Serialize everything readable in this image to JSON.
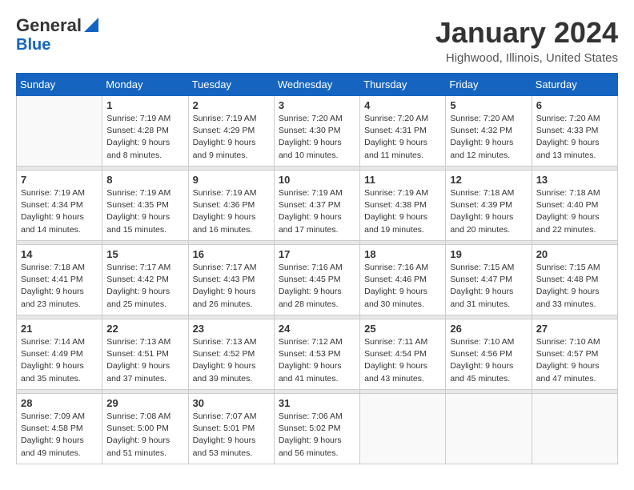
{
  "header": {
    "logo_line1": "General",
    "logo_line2": "Blue",
    "month_title": "January 2024",
    "location": "Highwood, Illinois, United States"
  },
  "weekdays": [
    "Sunday",
    "Monday",
    "Tuesday",
    "Wednesday",
    "Thursday",
    "Friday",
    "Saturday"
  ],
  "weeks": [
    [
      {
        "day": "",
        "info": ""
      },
      {
        "day": "1",
        "info": "Sunrise: 7:19 AM\nSunset: 4:28 PM\nDaylight: 9 hours\nand 8 minutes."
      },
      {
        "day": "2",
        "info": "Sunrise: 7:19 AM\nSunset: 4:29 PM\nDaylight: 9 hours\nand 9 minutes."
      },
      {
        "day": "3",
        "info": "Sunrise: 7:20 AM\nSunset: 4:30 PM\nDaylight: 9 hours\nand 10 minutes."
      },
      {
        "day": "4",
        "info": "Sunrise: 7:20 AM\nSunset: 4:31 PM\nDaylight: 9 hours\nand 11 minutes."
      },
      {
        "day": "5",
        "info": "Sunrise: 7:20 AM\nSunset: 4:32 PM\nDaylight: 9 hours\nand 12 minutes."
      },
      {
        "day": "6",
        "info": "Sunrise: 7:20 AM\nSunset: 4:33 PM\nDaylight: 9 hours\nand 13 minutes."
      }
    ],
    [
      {
        "day": "7",
        "info": "Sunrise: 7:19 AM\nSunset: 4:34 PM\nDaylight: 9 hours\nand 14 minutes."
      },
      {
        "day": "8",
        "info": "Sunrise: 7:19 AM\nSunset: 4:35 PM\nDaylight: 9 hours\nand 15 minutes."
      },
      {
        "day": "9",
        "info": "Sunrise: 7:19 AM\nSunset: 4:36 PM\nDaylight: 9 hours\nand 16 minutes."
      },
      {
        "day": "10",
        "info": "Sunrise: 7:19 AM\nSunset: 4:37 PM\nDaylight: 9 hours\nand 17 minutes."
      },
      {
        "day": "11",
        "info": "Sunrise: 7:19 AM\nSunset: 4:38 PM\nDaylight: 9 hours\nand 19 minutes."
      },
      {
        "day": "12",
        "info": "Sunrise: 7:18 AM\nSunset: 4:39 PM\nDaylight: 9 hours\nand 20 minutes."
      },
      {
        "day": "13",
        "info": "Sunrise: 7:18 AM\nSunset: 4:40 PM\nDaylight: 9 hours\nand 22 minutes."
      }
    ],
    [
      {
        "day": "14",
        "info": "Sunrise: 7:18 AM\nSunset: 4:41 PM\nDaylight: 9 hours\nand 23 minutes."
      },
      {
        "day": "15",
        "info": "Sunrise: 7:17 AM\nSunset: 4:42 PM\nDaylight: 9 hours\nand 25 minutes."
      },
      {
        "day": "16",
        "info": "Sunrise: 7:17 AM\nSunset: 4:43 PM\nDaylight: 9 hours\nand 26 minutes."
      },
      {
        "day": "17",
        "info": "Sunrise: 7:16 AM\nSunset: 4:45 PM\nDaylight: 9 hours\nand 28 minutes."
      },
      {
        "day": "18",
        "info": "Sunrise: 7:16 AM\nSunset: 4:46 PM\nDaylight: 9 hours\nand 30 minutes."
      },
      {
        "day": "19",
        "info": "Sunrise: 7:15 AM\nSunset: 4:47 PM\nDaylight: 9 hours\nand 31 minutes."
      },
      {
        "day": "20",
        "info": "Sunrise: 7:15 AM\nSunset: 4:48 PM\nDaylight: 9 hours\nand 33 minutes."
      }
    ],
    [
      {
        "day": "21",
        "info": "Sunrise: 7:14 AM\nSunset: 4:49 PM\nDaylight: 9 hours\nand 35 minutes."
      },
      {
        "day": "22",
        "info": "Sunrise: 7:13 AM\nSunset: 4:51 PM\nDaylight: 9 hours\nand 37 minutes."
      },
      {
        "day": "23",
        "info": "Sunrise: 7:13 AM\nSunset: 4:52 PM\nDaylight: 9 hours\nand 39 minutes."
      },
      {
        "day": "24",
        "info": "Sunrise: 7:12 AM\nSunset: 4:53 PM\nDaylight: 9 hours\nand 41 minutes."
      },
      {
        "day": "25",
        "info": "Sunrise: 7:11 AM\nSunset: 4:54 PM\nDaylight: 9 hours\nand 43 minutes."
      },
      {
        "day": "26",
        "info": "Sunrise: 7:10 AM\nSunset: 4:56 PM\nDaylight: 9 hours\nand 45 minutes."
      },
      {
        "day": "27",
        "info": "Sunrise: 7:10 AM\nSunset: 4:57 PM\nDaylight: 9 hours\nand 47 minutes."
      }
    ],
    [
      {
        "day": "28",
        "info": "Sunrise: 7:09 AM\nSunset: 4:58 PM\nDaylight: 9 hours\nand 49 minutes."
      },
      {
        "day": "29",
        "info": "Sunrise: 7:08 AM\nSunset: 5:00 PM\nDaylight: 9 hours\nand 51 minutes."
      },
      {
        "day": "30",
        "info": "Sunrise: 7:07 AM\nSunset: 5:01 PM\nDaylight: 9 hours\nand 53 minutes."
      },
      {
        "day": "31",
        "info": "Sunrise: 7:06 AM\nSunset: 5:02 PM\nDaylight: 9 hours\nand 56 minutes."
      },
      {
        "day": "",
        "info": ""
      },
      {
        "day": "",
        "info": ""
      },
      {
        "day": "",
        "info": ""
      }
    ]
  ]
}
